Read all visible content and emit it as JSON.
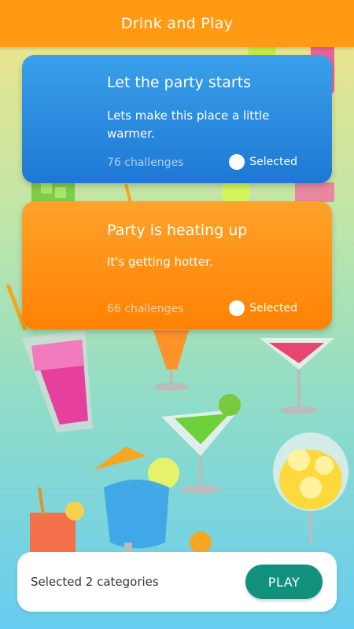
{
  "app_bar": {
    "title": "Drink and Play"
  },
  "categories": [
    {
      "title": "Let the party starts",
      "description": "Lets make this place a little warmer.",
      "count": "76 challenges",
      "selected_label": "Selected"
    },
    {
      "title": "Party is heating up",
      "description": "It's getting hotter.",
      "count": "66 challenges",
      "selected_label": "Selected"
    }
  ],
  "footer": {
    "selected_text": "Selected 2 categories",
    "play_label": "PLAY"
  },
  "colors": {
    "primary": "#ff9a12",
    "card_blue": "#2a8ee0",
    "card_orange": "#ff9415",
    "play_button": "#12907e"
  }
}
